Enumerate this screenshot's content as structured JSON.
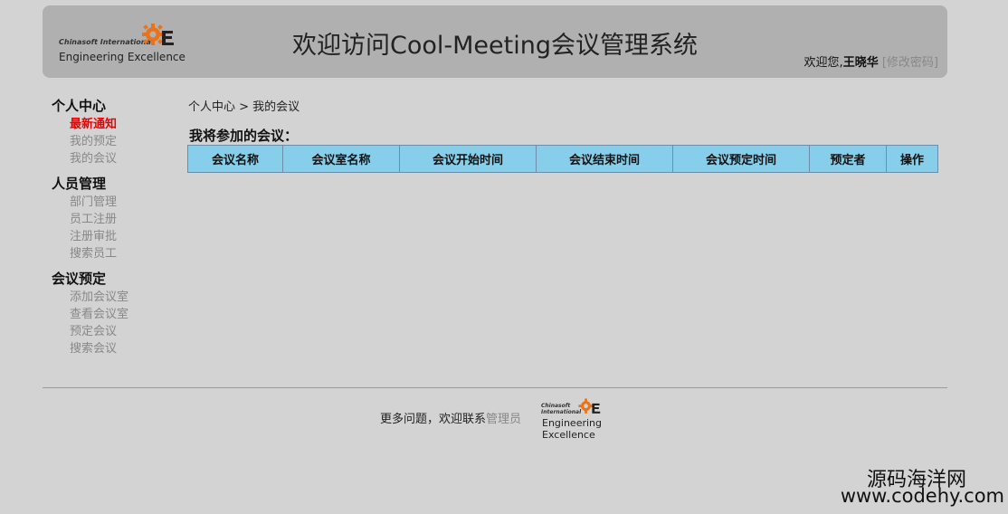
{
  "header": {
    "logo_small": "Chinasoft International",
    "logo_big": "Engineering Excellence",
    "title": "欢迎访问Cool-Meeting会议管理系统",
    "welcome_prefix": "欢迎您,",
    "username": "王晓华",
    "change_password": "[修改密码]"
  },
  "sidebar": {
    "groups": [
      {
        "title": "个人中心",
        "items": [
          "最新通知",
          "我的预定",
          "我的会议"
        ]
      },
      {
        "title": "人员管理",
        "items": [
          "部门管理",
          "员工注册",
          "注册审批",
          "搜索员工"
        ]
      },
      {
        "title": "会议预定",
        "items": [
          "添加会议室",
          "查看会议室",
          "预定会议",
          "搜索会议"
        ]
      }
    ]
  },
  "breadcrumb": "个人中心 > 我的会议",
  "section_title": "我将参加的会议：",
  "table": {
    "columns": [
      "会议名称",
      "会议室名称",
      "会议开始时间",
      "会议结束时间",
      "会议预定时间",
      "预定者",
      "操作"
    ]
  },
  "footer": {
    "text": "更多问题，欢迎联系",
    "admin_link": "管理员",
    "logo_small": "Chinasoft International",
    "logo_big_1": "Engineering",
    "logo_big_2": "Excellence"
  },
  "watermark": {
    "line1": "源码海洋网",
    "line2": "www.codehy.com"
  },
  "colors": {
    "background": "#d3d3d3",
    "header_bg": "#b0b0b0",
    "table_header_bg": "#87ceeb",
    "active_item": "#ee0000",
    "muted_link": "#888888",
    "logo_gear": "#e8731a"
  }
}
